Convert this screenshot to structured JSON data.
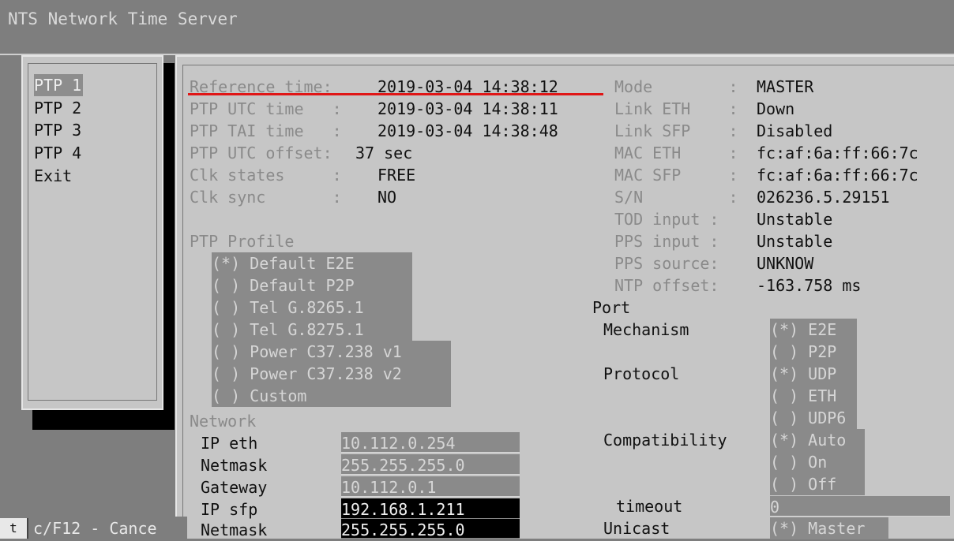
{
  "window": {
    "title": "NTS Network Time Server"
  },
  "menu": {
    "items": [
      {
        "label": "PTP 1",
        "selected": true
      },
      {
        "label": "PTP 2",
        "selected": false
      },
      {
        "label": "PTP 3",
        "selected": false
      },
      {
        "label": "PTP 4",
        "selected": false
      },
      {
        "label": "Exit",
        "selected": false
      }
    ]
  },
  "status": {
    "reference_time_label": "Reference time:",
    "reference_time_value": "2019-03-04 14:38:12",
    "utc_label": "PTP UTC time   :",
    "utc_value": "2019-03-04 14:38:11",
    "tai_label": "PTP TAI time   :",
    "tai_value": "2019-03-04 14:38:48",
    "utc_offset_label": "PTP UTC offset:",
    "utc_offset_value": "37 sec",
    "clk_states_label": "Clk states     :",
    "clk_states_value": "FREE",
    "clk_sync_label": "Clk sync       :",
    "clk_sync_value": "NO"
  },
  "info": {
    "mode_label": "Mode        :",
    "mode_value": "MASTER",
    "link_eth_label": "Link ETH    :",
    "link_eth_value": "Down",
    "link_sfp_label": "Link SFP    :",
    "link_sfp_value": "Disabled",
    "mac_eth_label": "MAC ETH     :",
    "mac_eth_value": "fc:af:6a:ff:66:7c",
    "mac_sfp_label": "MAC SFP     :",
    "mac_sfp_value": "fc:af:6a:ff:66:7c",
    "sn_label": "S/N         :",
    "sn_value": "026236.5.29151",
    "tod_label": "TOD input :",
    "tod_value": "Unstable",
    "pps_input_label": "PPS input :",
    "pps_input_value": "Unstable",
    "pps_source_label": "PPS source:",
    "pps_source_value": "UNKNOW",
    "ntp_offset_label": "NTP offset:",
    "ntp_offset_value": "-163.758 ms"
  },
  "profile": {
    "heading": "PTP Profile",
    "options": [
      "(*) Default E2E",
      "( ) Default P2P",
      "( ) Tel G.8265.1",
      "( ) Tel G.8275.1",
      "( ) Power C37.238 v1",
      "( ) Power C37.238 v2",
      "( ) Custom"
    ]
  },
  "port": {
    "heading": "Port",
    "mechanism_label": "Mechanism",
    "mechanism_options": [
      "(*) E2E",
      "( ) P2P"
    ],
    "protocol_label": "Protocol",
    "protocol_options": [
      "(*) UDP",
      "( ) ETH",
      "( ) UDP6"
    ],
    "compat_label": "Compatibility",
    "compat_options": [
      "(*) Auto",
      "( ) On",
      "( ) Off"
    ],
    "timeout_label": "timeout",
    "timeout_value": "0",
    "unicast_label": "Unicast",
    "unicast_option": "(*) Master"
  },
  "network": {
    "heading": "Network",
    "ip_eth_label": "IP eth",
    "ip_eth_value": "10.112.0.254",
    "netmask_label": "Netmask",
    "netmask_value": "255.255.255.0",
    "gateway_label": "Gateway",
    "gateway_value": "10.112.0.1",
    "ip_sfp_label": "IP sfp",
    "ip_sfp_value": "192.168.1.211",
    "netmask2_label": "Netmask",
    "netmask2_value": "255.255.255.0"
  },
  "footer": {
    "icon_text": "t",
    "hint": "c/F12 - Cance"
  }
}
